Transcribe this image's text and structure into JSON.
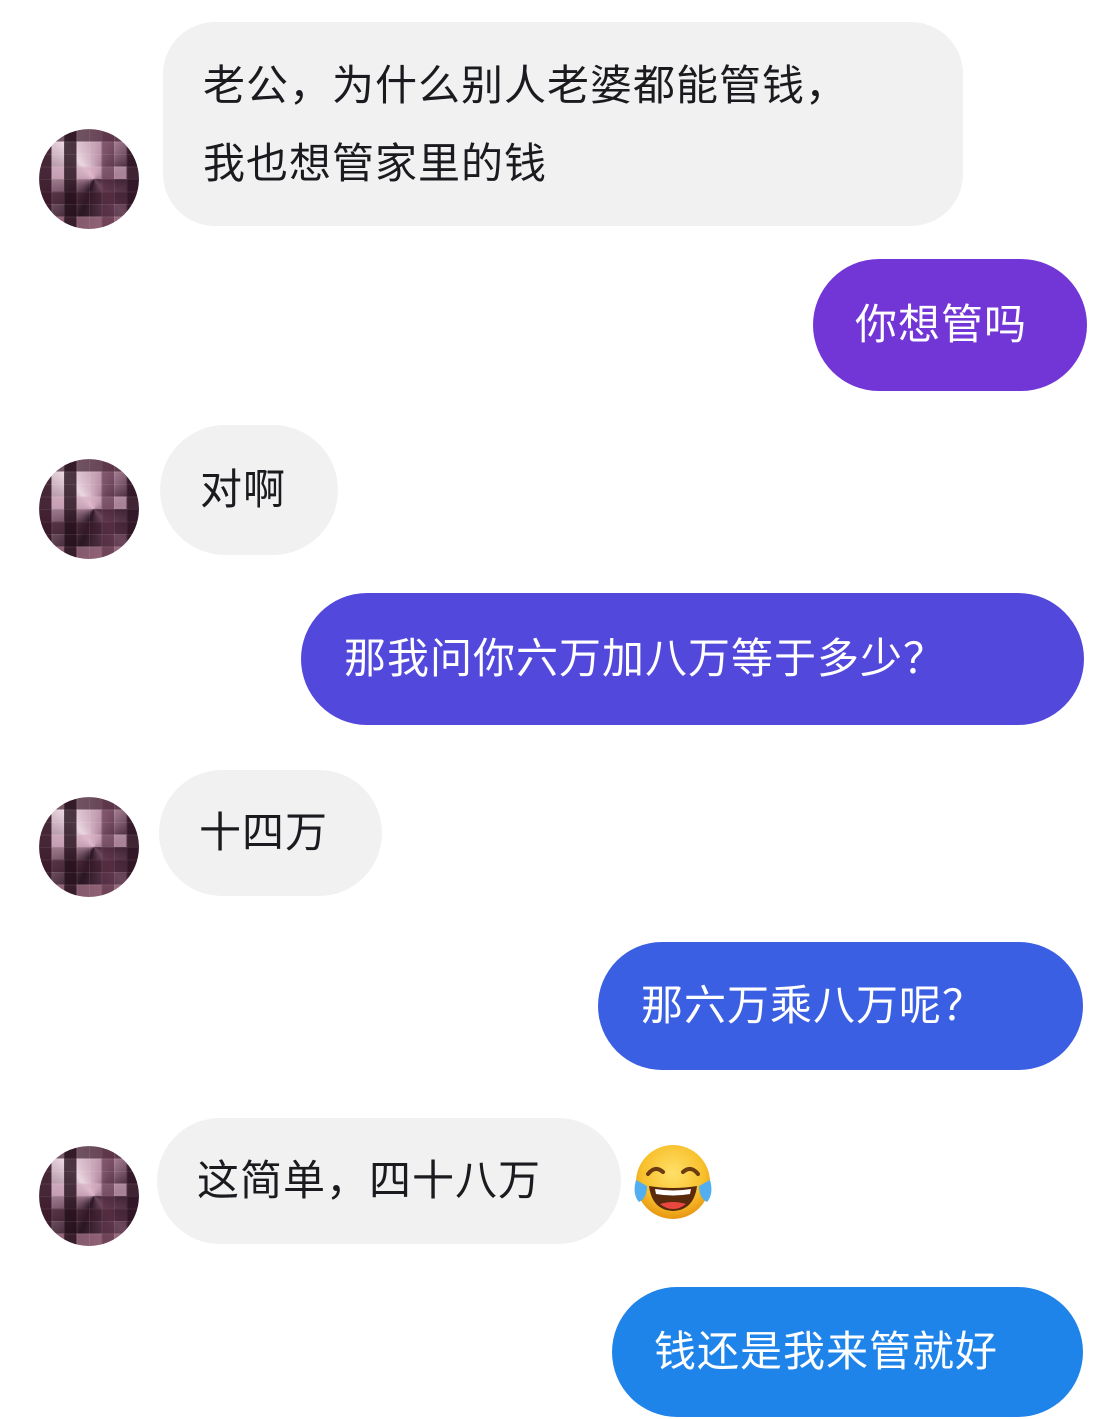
{
  "conversation": {
    "messages": [
      {
        "sender": "other",
        "text": "老公，为什么别人老婆都能管钱，\n我也想管家里的钱"
      },
      {
        "sender": "self",
        "text": "你想管吗"
      },
      {
        "sender": "other",
        "text": "对啊"
      },
      {
        "sender": "self",
        "text": "那我问你六万加八万等于多少？"
      },
      {
        "sender": "other",
        "text": "十四万"
      },
      {
        "sender": "self",
        "text": "那六万乘八万呢？"
      },
      {
        "sender": "other",
        "text": "这简单，四十八万"
      },
      {
        "sender": "self",
        "text": "钱还是我来管就好"
      }
    ],
    "reaction_emoji": "tears-of-joy-emoji",
    "colors": {
      "incoming_bubble": "#f1f1f2",
      "incoming_text": "#1b1b1f",
      "outgoing_text": "#ffffff",
      "outgoing_gradient": [
        "#7a38d9",
        "#5448dd",
        "#3d5de2",
        "#2f6fe6",
        "#1f86ea"
      ]
    }
  }
}
